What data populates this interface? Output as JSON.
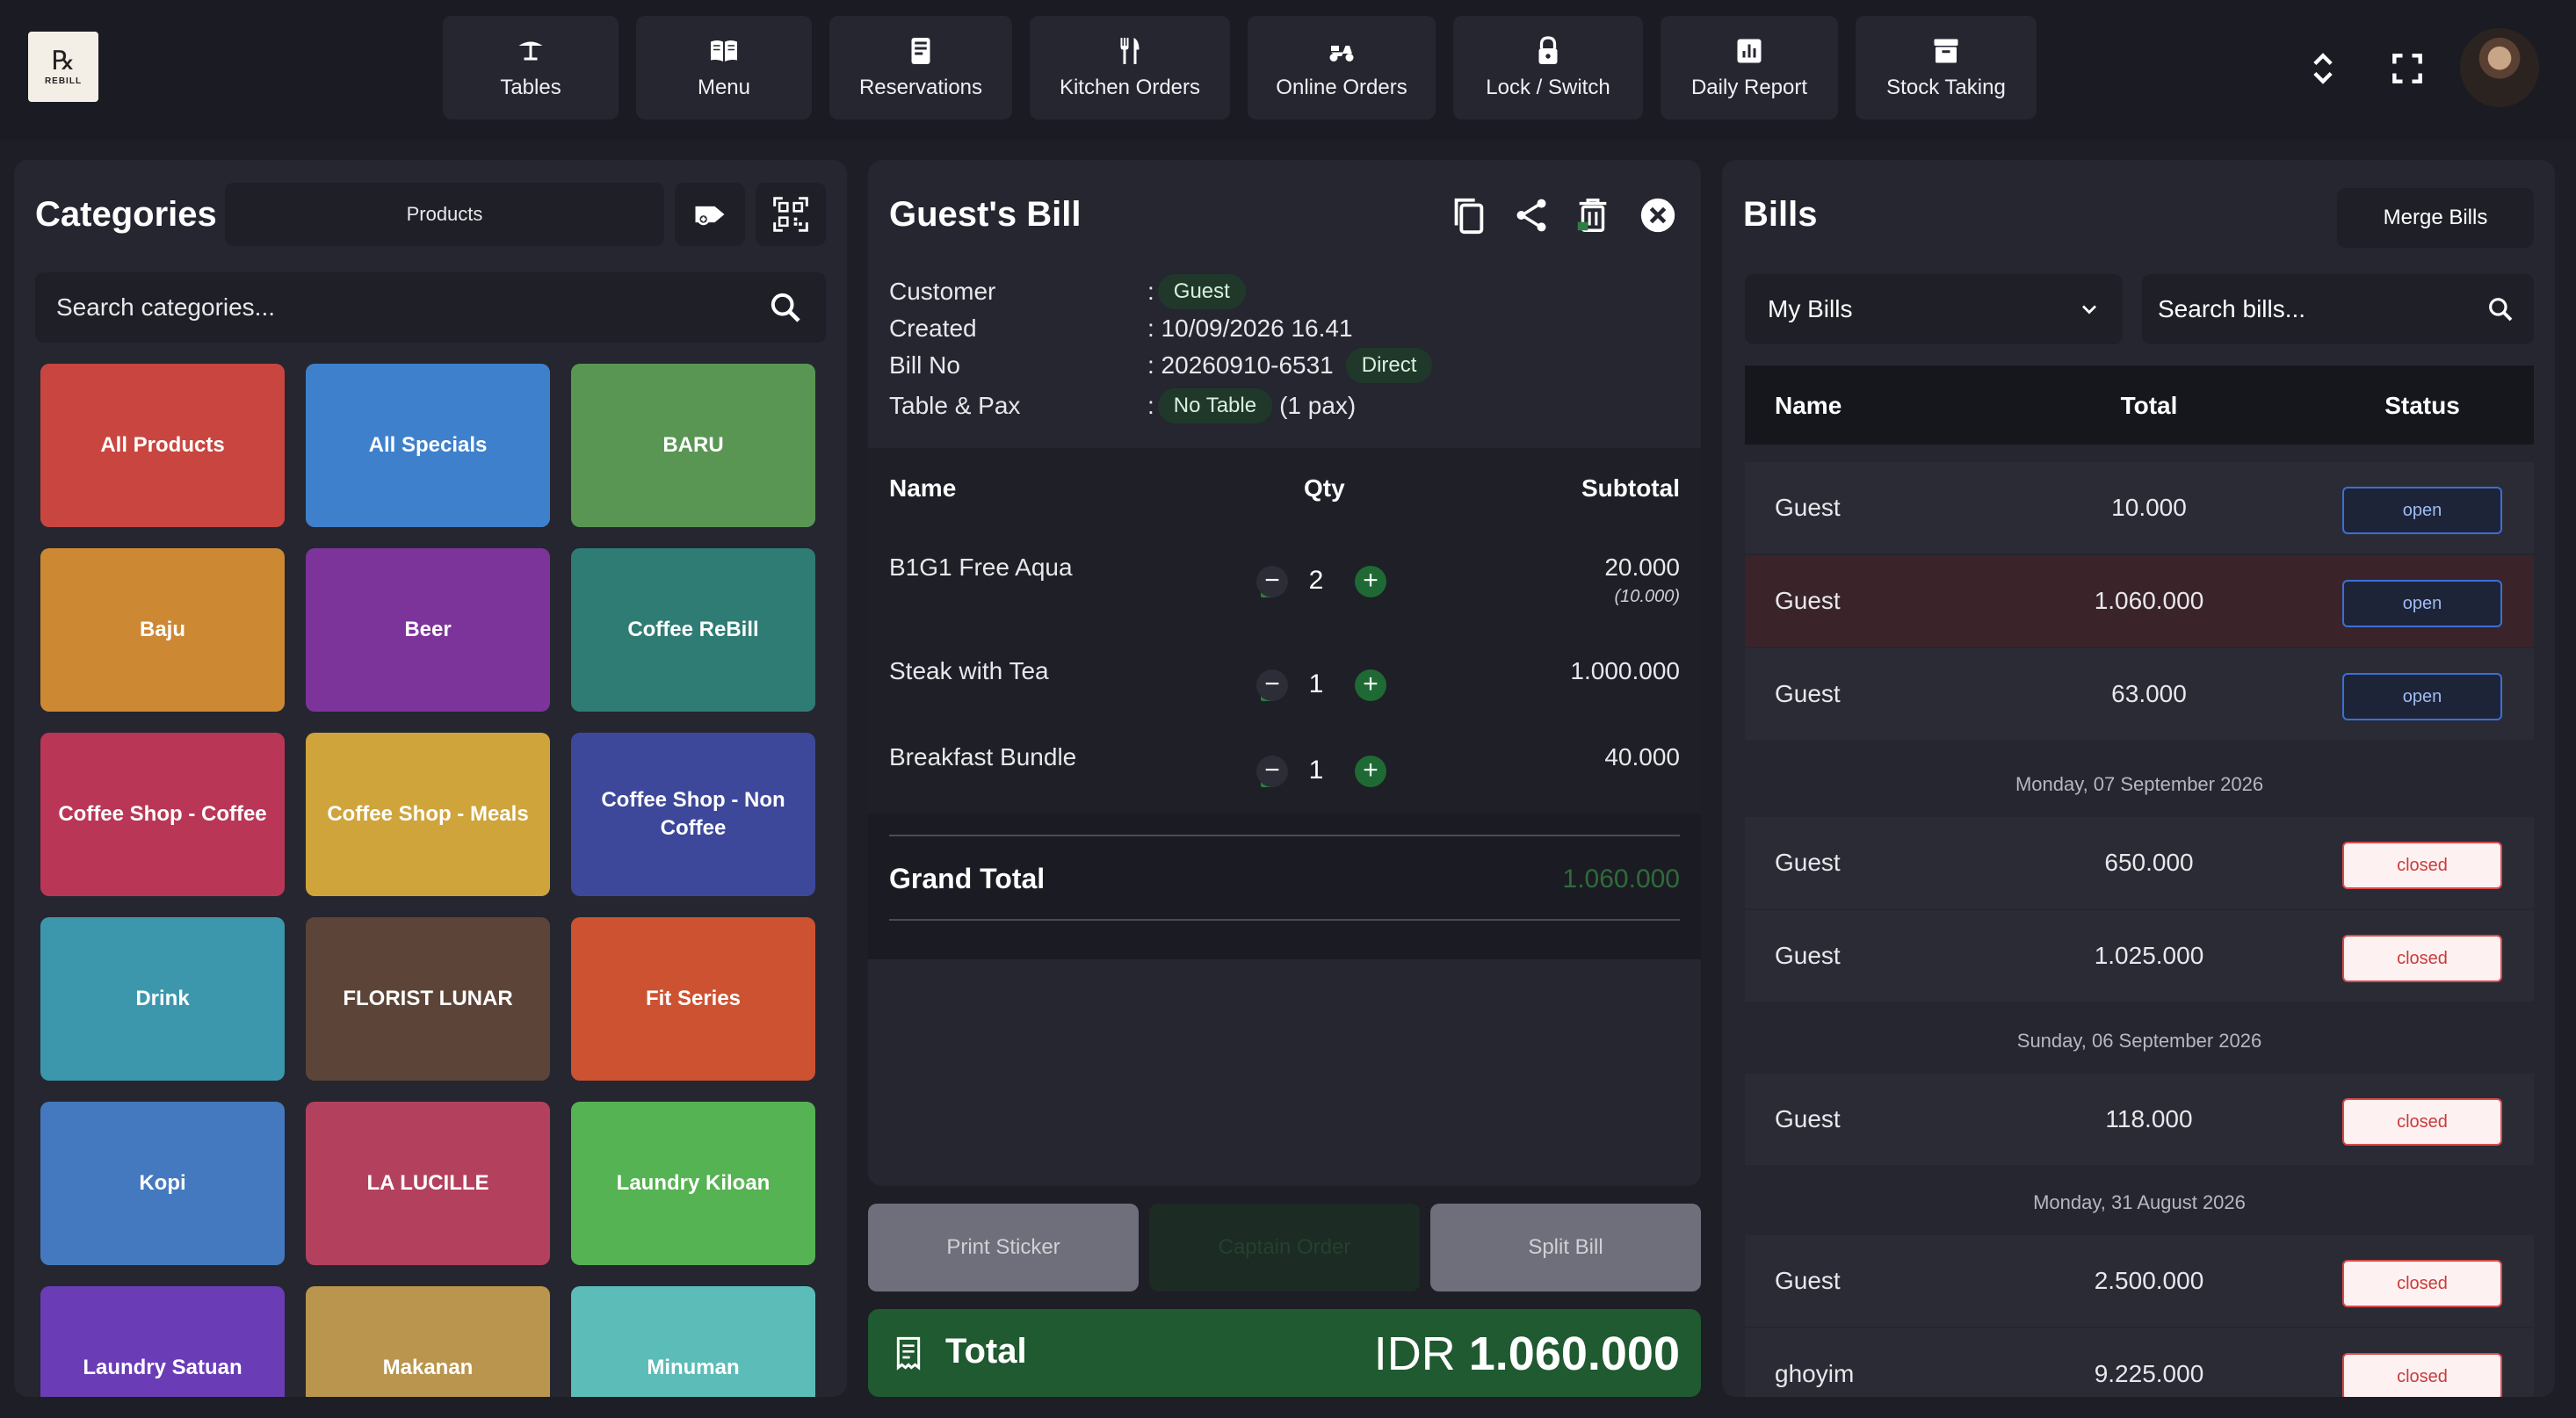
{
  "app": {
    "logo_text": "REBILL"
  },
  "nav": {
    "items": [
      {
        "label": "Tables",
        "icon": "table-umbrella-icon"
      },
      {
        "label": "Menu",
        "icon": "book-open-icon"
      },
      {
        "label": "Reservations",
        "icon": "tablet-icon"
      },
      {
        "label": "Kitchen Orders",
        "icon": "fork-knife-icon"
      },
      {
        "label": "Online Orders",
        "icon": "scooter-icon"
      },
      {
        "label": "Lock / Switch",
        "icon": "lock-icon"
      },
      {
        "label": "Daily Report",
        "icon": "bar-chart-icon"
      },
      {
        "label": "Stock Taking",
        "icon": "archive-box-icon"
      }
    ]
  },
  "categories": {
    "title": "Categories",
    "products_label": "Products",
    "search_placeholder": "Search categories...",
    "tiles": [
      {
        "label": "All Products",
        "color": "#c8463f"
      },
      {
        "label": "All Specials",
        "color": "#3f80cc"
      },
      {
        "label": "BARU",
        "color": "#5a9653"
      },
      {
        "label": "Baju",
        "color": "#cd8834"
      },
      {
        "label": "Beer",
        "color": "#7c349a"
      },
      {
        "label": "Coffee ReBill",
        "color": "#2f7c74"
      },
      {
        "label": "Coffee Shop - Coffee",
        "color": "#b93657"
      },
      {
        "label": "Coffee Shop - Meals",
        "color": "#cfa43b"
      },
      {
        "label": "Coffee Shop - Non Coffee",
        "color": "#3d489a"
      },
      {
        "label": "Drink",
        "color": "#3c97ad"
      },
      {
        "label": "FLORIST LUNAR",
        "color": "#5c4438"
      },
      {
        "label": "Fit Series",
        "color": "#cd5231"
      },
      {
        "label": "Kopi",
        "color": "#4479c0"
      },
      {
        "label": "LA LUCILLE",
        "color": "#b3415e"
      },
      {
        "label": "Laundry Kiloan",
        "color": "#56b353"
      },
      {
        "label": "Laundry Satuan",
        "color": "#6a3cb6"
      },
      {
        "label": "Makanan",
        "color": "#b9954d"
      },
      {
        "label": "Minuman",
        "color": "#5cbcb8"
      }
    ]
  },
  "bill": {
    "title": "Guest's Bill",
    "customer_label": "Customer",
    "customer_value": "Guest",
    "created_label": "Created",
    "created_value": ": 10/09/2026 16.41",
    "billno_label": "Bill No",
    "billno_value": ": 20260910-6531",
    "billno_badge": "Direct",
    "table_label": "Table & Pax",
    "table_value": "No Table",
    "pax_value": "(1 pax)",
    "colon": ":",
    "head_name": "Name",
    "head_qty": "Qty",
    "head_subtotal": "Subtotal",
    "items": [
      {
        "name": "B1G1 Free Aqua",
        "qty": "2",
        "subtotal": "20.000",
        "note": "(10.000)"
      },
      {
        "name": "Steak with Tea",
        "qty": "1",
        "subtotal": "1.000.000",
        "note": ""
      },
      {
        "name": "Breakfast Bundle",
        "qty": "1",
        "subtotal": "40.000",
        "note": ""
      }
    ],
    "grand_total_label": "Grand Total",
    "grand_total_value": "1.060.000",
    "actions": {
      "print_sticker": "Print Sticker",
      "captain_order": "Captain Order",
      "split_bill": "Split Bill"
    },
    "total_label": "Total",
    "total_currency": "IDR",
    "total_value": "1.060.000"
  },
  "bills": {
    "title": "Bills",
    "merge_label": "Merge Bills",
    "filter_value": "My Bills",
    "search_placeholder": "Search bills...",
    "head_name": "Name",
    "head_total": "Total",
    "head_status": "Status",
    "rows": [
      {
        "name": "Guest",
        "total": "10.000",
        "status": "open"
      },
      {
        "name": "Guest",
        "total": "1.060.000",
        "status": "open"
      },
      {
        "name": "Guest",
        "total": "63.000",
        "status": "open"
      },
      {
        "name": "Guest",
        "total": "650.000",
        "status": "closed"
      },
      {
        "name": "Guest",
        "total": "1.025.000",
        "status": "closed"
      },
      {
        "name": "Guest",
        "total": "118.000",
        "status": "closed"
      },
      {
        "name": "Guest",
        "total": "2.500.000",
        "status": "closed"
      },
      {
        "name": "ghoyim",
        "total": "9.225.000",
        "status": "closed"
      }
    ],
    "dates": [
      "Monday, 07 September 2026",
      "Sunday, 06 September 2026",
      "Monday, 31 August 2026"
    ]
  },
  "colors": {
    "accent_green": "#1f5a30",
    "selected_row": "#3a2429",
    "grand_total_green": "#2f6b3a"
  }
}
